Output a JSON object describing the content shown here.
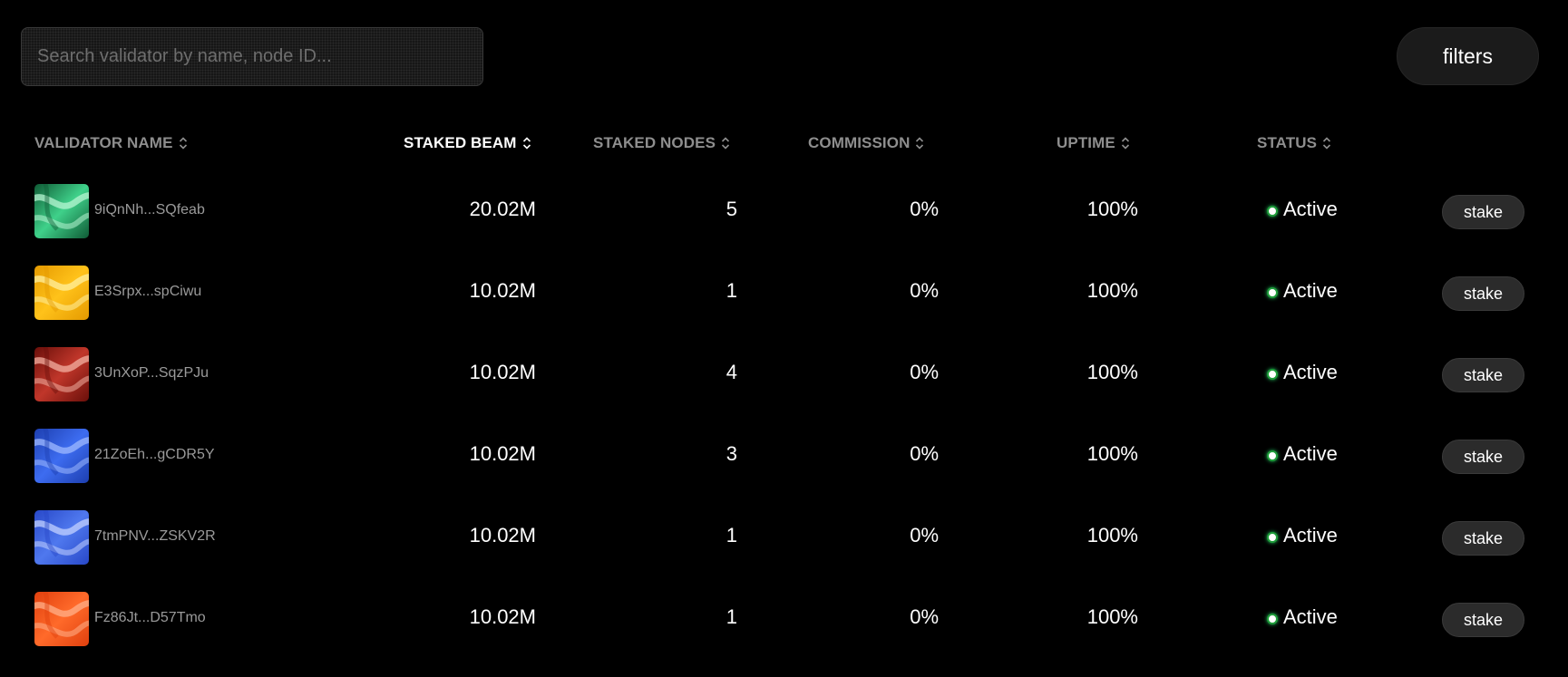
{
  "search": {
    "placeholder": "Search validator by name, node ID..."
  },
  "filters_label": "filters",
  "columns": [
    {
      "label": "VALIDATOR NAME"
    },
    {
      "label": "STAKED BEAM",
      "active": true
    },
    {
      "label": "STAKED NODES"
    },
    {
      "label": "COMMISSION"
    },
    {
      "label": "UPTIME"
    },
    {
      "label": "STATUS"
    }
  ],
  "rows": [
    {
      "name": "9iQnNh...SQfeab",
      "staked_beam": "20.02M",
      "staked_nodes": "5",
      "commission": "0%",
      "uptime": "100%",
      "status": "Active",
      "action": "stake",
      "avatar_colors": [
        "#0f5a35",
        "#3fd18a",
        "#b8f5d3"
      ]
    },
    {
      "name": "E3Srpx...spCiwu",
      "staked_beam": "10.02M",
      "staked_nodes": "1",
      "commission": "0%",
      "uptime": "100%",
      "status": "Active",
      "action": "stake",
      "avatar_colors": [
        "#e59a00",
        "#ffc21a",
        "#fff0a0"
      ]
    },
    {
      "name": "3UnXoP...SqzPJu",
      "staked_beam": "10.02M",
      "staked_nodes": "4",
      "commission": "0%",
      "uptime": "100%",
      "status": "Active",
      "action": "stake",
      "avatar_colors": [
        "#6a0f0a",
        "#c0362a",
        "#f3b0a2"
      ]
    },
    {
      "name": "21ZoEh...gCDR5Y",
      "staked_beam": "10.02M",
      "staked_nodes": "3",
      "commission": "0%",
      "uptime": "100%",
      "status": "Active",
      "action": "stake",
      "avatar_colors": [
        "#1d3fb0",
        "#3d6cf0",
        "#9fbaff"
      ]
    },
    {
      "name": "7tmPNV...ZSKV2R",
      "staked_beam": "10.02M",
      "staked_nodes": "1",
      "commission": "0%",
      "uptime": "100%",
      "status": "Active",
      "action": "stake",
      "avatar_colors": [
        "#2848c8",
        "#4f78ee",
        "#c3d2ff"
      ]
    },
    {
      "name": "Fz86Jt...D57Tmo",
      "staked_beam": "10.02M",
      "staked_nodes": "1",
      "commission": "0%",
      "uptime": "100%",
      "status": "Active",
      "action": "stake",
      "avatar_colors": [
        "#e0400e",
        "#ff6a2a",
        "#ffb08a"
      ]
    }
  ]
}
